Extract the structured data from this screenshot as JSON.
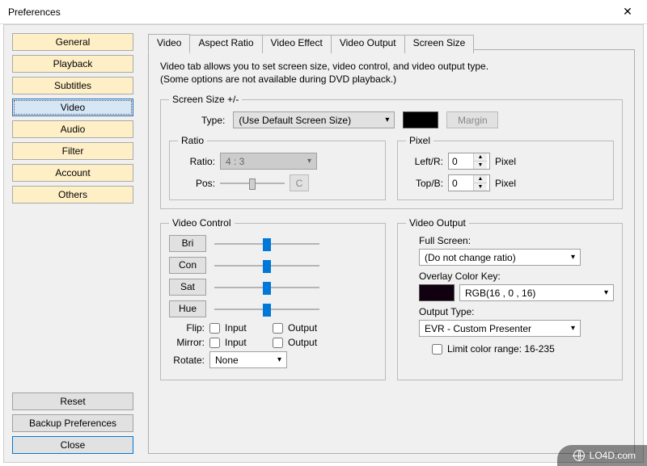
{
  "title": "Preferences",
  "sidebar": {
    "items": [
      {
        "label": "General"
      },
      {
        "label": "Playback"
      },
      {
        "label": "Subtitles"
      },
      {
        "label": "Video",
        "selected": true
      },
      {
        "label": "Audio"
      },
      {
        "label": "Filter"
      },
      {
        "label": "Account"
      },
      {
        "label": "Others"
      }
    ],
    "reset": "Reset",
    "backup": "Backup Preferences",
    "close": "Close"
  },
  "tabs": [
    {
      "label": "Video",
      "active": true
    },
    {
      "label": "Aspect Ratio"
    },
    {
      "label": "Video Effect"
    },
    {
      "label": "Video Output"
    },
    {
      "label": "Screen Size"
    }
  ],
  "description": "Video tab allows you to set screen size, video control, and video output type.\n(Some options are not available during DVD playback.)",
  "screenSize": {
    "legend": "Screen Size +/-",
    "typeLabel": "Type:",
    "typeValue": "(Use Default Screen Size)",
    "margin": "Margin"
  },
  "ratio": {
    "legend": "Ratio",
    "ratioLabel": "Ratio:",
    "ratioValue": "4 : 3",
    "posLabel": "Pos:",
    "cBtn": "C"
  },
  "pixel": {
    "legend": "Pixel",
    "leftLabel": "Left/R:",
    "leftValue": "0",
    "topLabel": "Top/B:",
    "topValue": "0",
    "unit": "Pixel"
  },
  "videoControl": {
    "legend": "Video Control",
    "bri": "Bri",
    "con": "Con",
    "sat": "Sat",
    "hue": "Hue",
    "flipLabel": "Flip:",
    "mirrorLabel": "Mirror:",
    "rotateLabel": "Rotate:",
    "input": "Input",
    "output": "Output",
    "rotateValue": "None"
  },
  "videoOutput": {
    "legend": "Video Output",
    "fullScreenLabel": "Full Screen:",
    "fullScreenValue": "(Do not change ratio)",
    "overlayLabel": "Overlay Color Key:",
    "overlayValue": "RGB(16 , 0 , 16)",
    "outputTypeLabel": "Output Type:",
    "outputTypeValue": "EVR - Custom Presenter",
    "limitLabel": "Limit color range: 16-235"
  },
  "watermark": "LO4D.com"
}
